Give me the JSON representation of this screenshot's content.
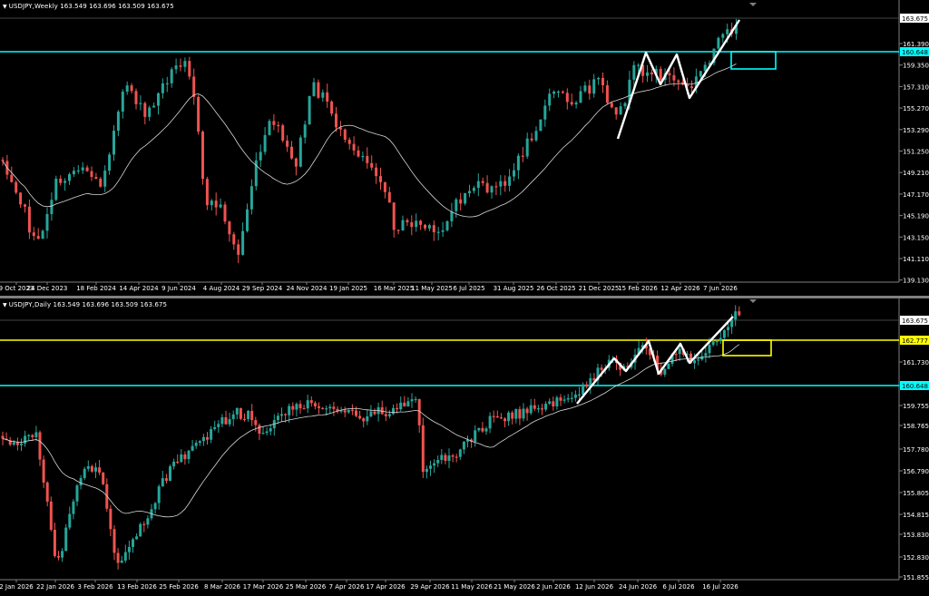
{
  "colors": {
    "background": "#000000",
    "bull": "#26a69a",
    "bear": "#ef5350",
    "ma": "#d8d8d8",
    "cyan": "#00ffff",
    "yellow": "#ffff00",
    "pattern": "#ffffff",
    "axis_text": "#ffffff",
    "price_tag_bg": "#ffffff",
    "price_tag_text": "#000000"
  },
  "panes": [
    {
      "id": "weekly",
      "header": "USDJPY,Weekly  163.549 163.696 163.509 163.675",
      "y_ticks": [
        "161.390",
        "159.350",
        "157.310",
        "155.270",
        "153.290",
        "151.250",
        "149.210",
        "147.170",
        "145.190",
        "143.150",
        "141.110",
        "139.130"
      ],
      "x_ticks": [
        "9 Oct 2023",
        "24 Dec 2023",
        "18 Feb 2024",
        "14 Apr 2024",
        "9 Jun 2024",
        "4 Aug 2024",
        "29 Sep 2024",
        "24 Nov 2024",
        "19 Jan 2025",
        "16 Mar 2025",
        "11 May 2025",
        "6 Jul 2025",
        "31 Aug 2025",
        "26 Oct 2025",
        "21 Dec 2025",
        "15 Feb 2026",
        "12 Apr 2026",
        "7 Jun 2026"
      ],
      "price_tag": "163.675",
      "level_tag": "160.648",
      "ma_icon": "dropdown-triangle-icon"
    },
    {
      "id": "daily",
      "header": "USDJPY,Daily  163.549 163.696 163.509 163.675",
      "y_ticks": [
        "161.730",
        "160.648",
        "159.755",
        "158.765",
        "157.780",
        "156.790",
        "155.805",
        "154.815",
        "153.830",
        "152.830",
        "151.855"
      ],
      "x_ticks": [
        "2 Jan 2026",
        "22 Jan 2026",
        "3 Feb 2026",
        "13 Feb 2026",
        "25 Feb 2026",
        "8 Mar 2026",
        "17 Mar 2026",
        "25 Mar 2026",
        "7 Apr 2026",
        "17 Apr 2026",
        "29 Apr 2026",
        "11 May 2026",
        "21 May 2026",
        "2 Jun 2026",
        "12 Jun 2026",
        "24 Jun 2026",
        "6 Jul 2026",
        "16 Jul 2026"
      ],
      "price_tag": "163.675",
      "level_tag_yellow": "162.777",
      "level_tag_cyan": "160.648"
    }
  ]
}
